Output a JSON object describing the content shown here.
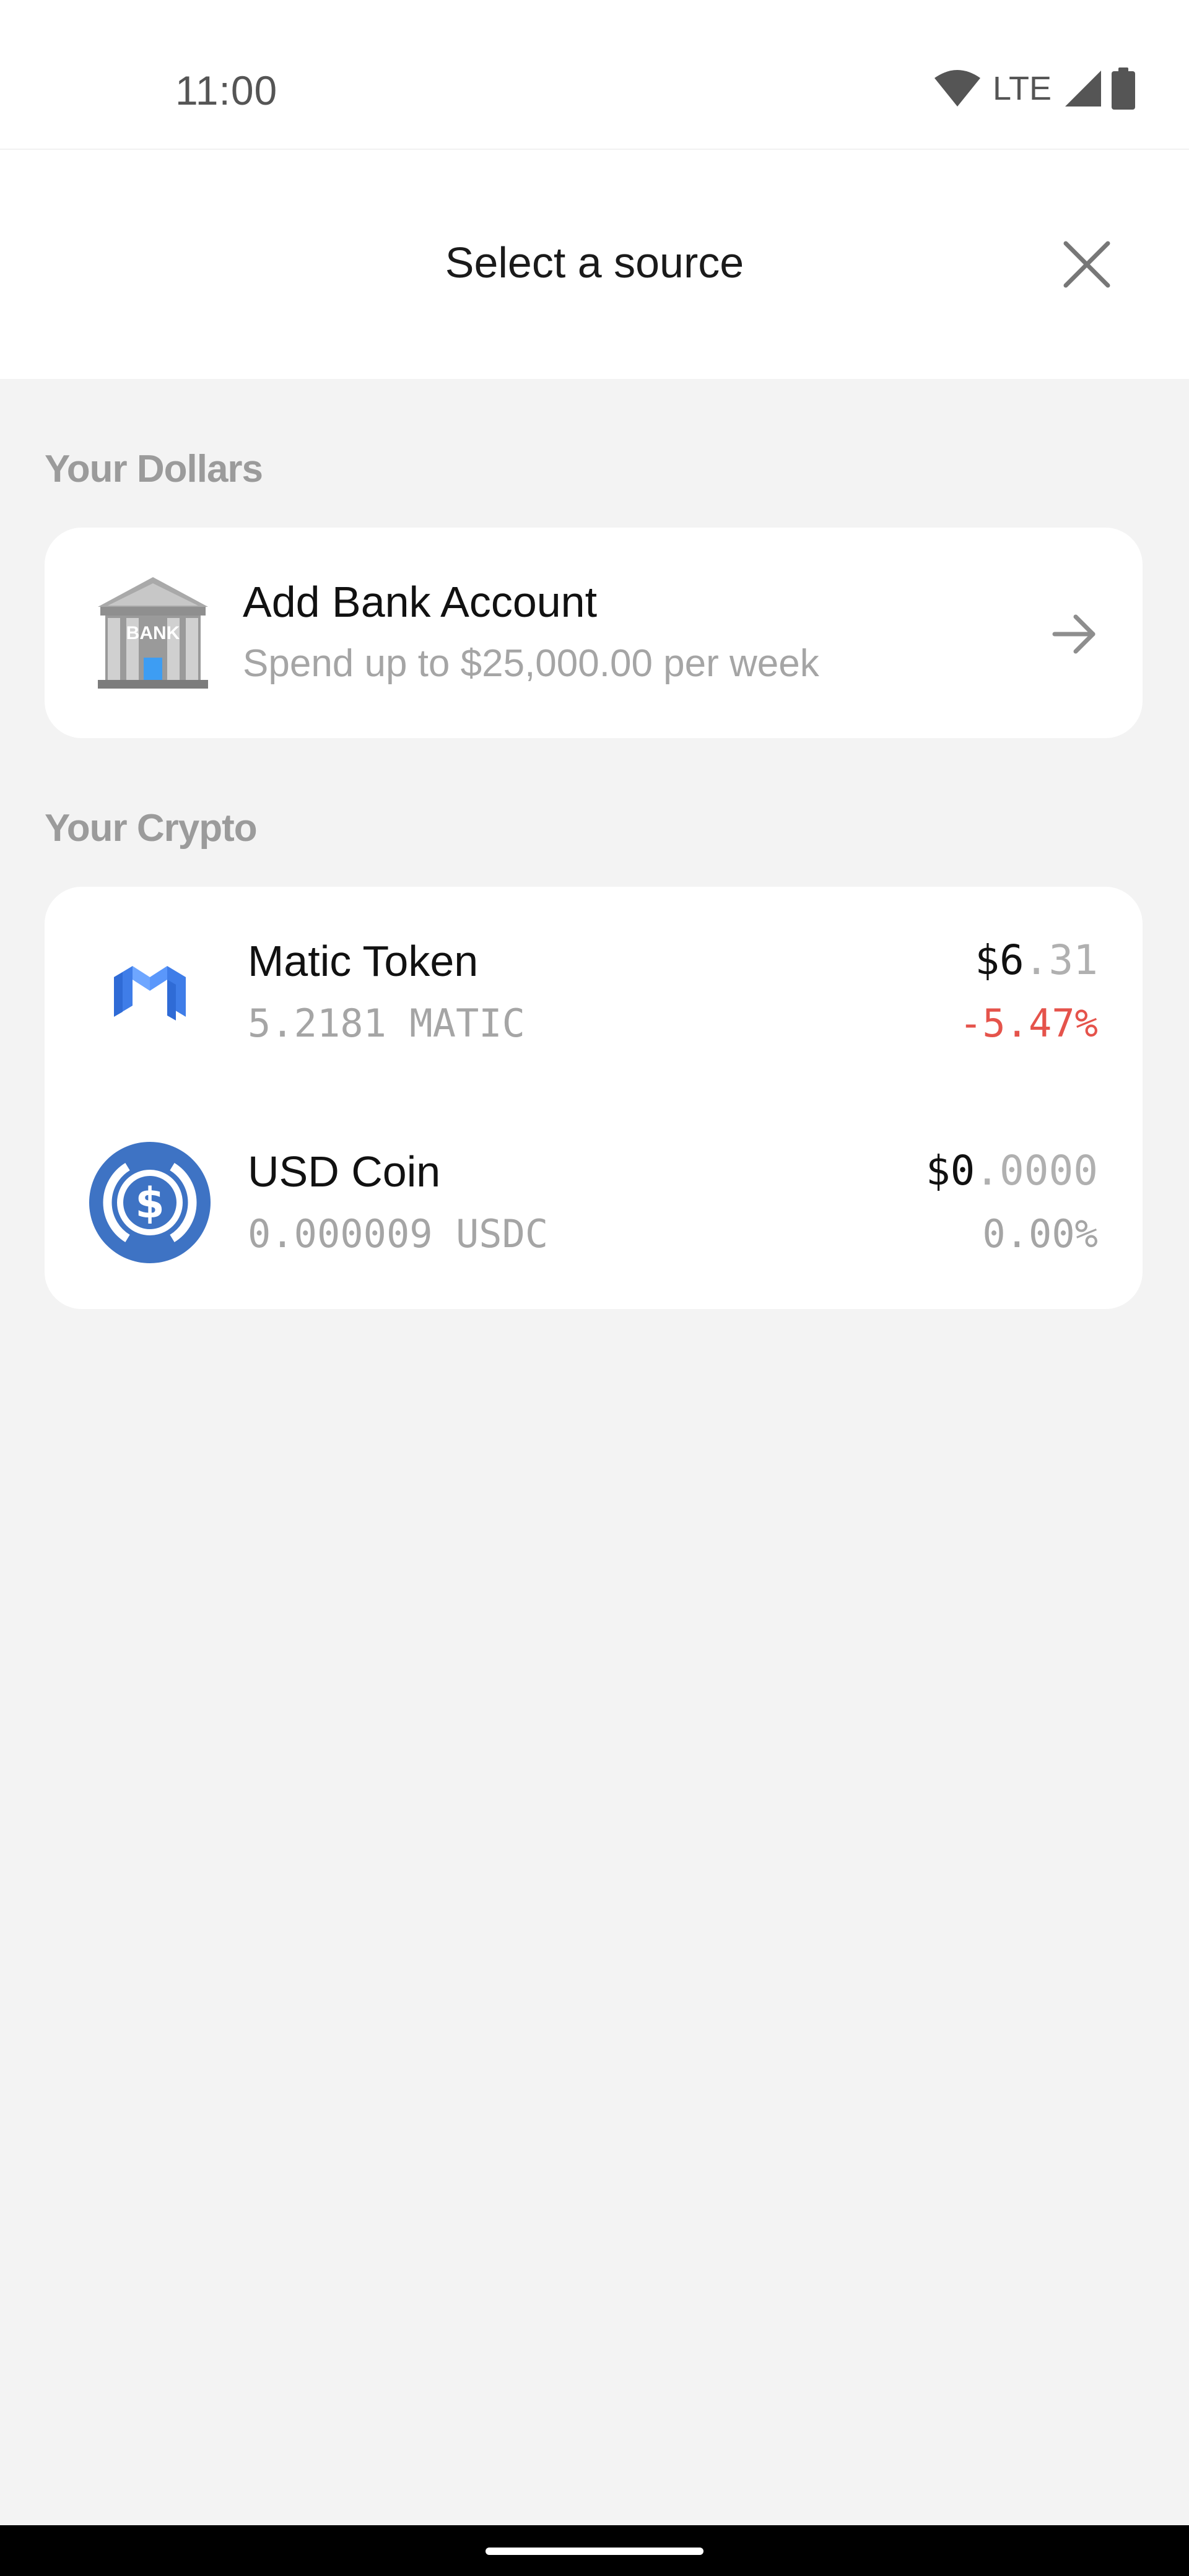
{
  "status_bar": {
    "time": "11:00",
    "network": "LTE",
    "icons": [
      "wifi-icon",
      "cellular-signal-icon",
      "battery-icon"
    ]
  },
  "header": {
    "title": "Select a source",
    "close_icon": "close-icon"
  },
  "dollars_section": {
    "label": "Your Dollars",
    "bank": {
      "icon": "bank-building-icon",
      "icon_text": "BANK",
      "title": "Add Bank Account",
      "subtitle": "Spend up to $25,000.00 per week",
      "action_icon": "arrow-right-icon"
    }
  },
  "crypto_section": {
    "label": "Your Crypto",
    "assets": [
      {
        "icon": "polygon-matic-logo-icon",
        "name": "Matic Token",
        "amount": "5.2181 MATIC",
        "value_main": "$6",
        "value_decimal": ".31",
        "change": "-5.47%",
        "change_color": "#e5534b"
      },
      {
        "icon": "usdc-logo-icon",
        "name": "USD Coin",
        "amount": "0.000009 USDC",
        "value_main": "$0",
        "value_decimal": ".0000",
        "change": "0.00%",
        "change_color": "#a5a5a5"
      }
    ]
  },
  "colors": {
    "background": "#f3f3f3",
    "card": "#ffffff",
    "negative": "#e5534b",
    "muted": "#a5a5a5",
    "usdc_blue": "#3e73c4",
    "matic_blue": "#4d8ef7"
  }
}
